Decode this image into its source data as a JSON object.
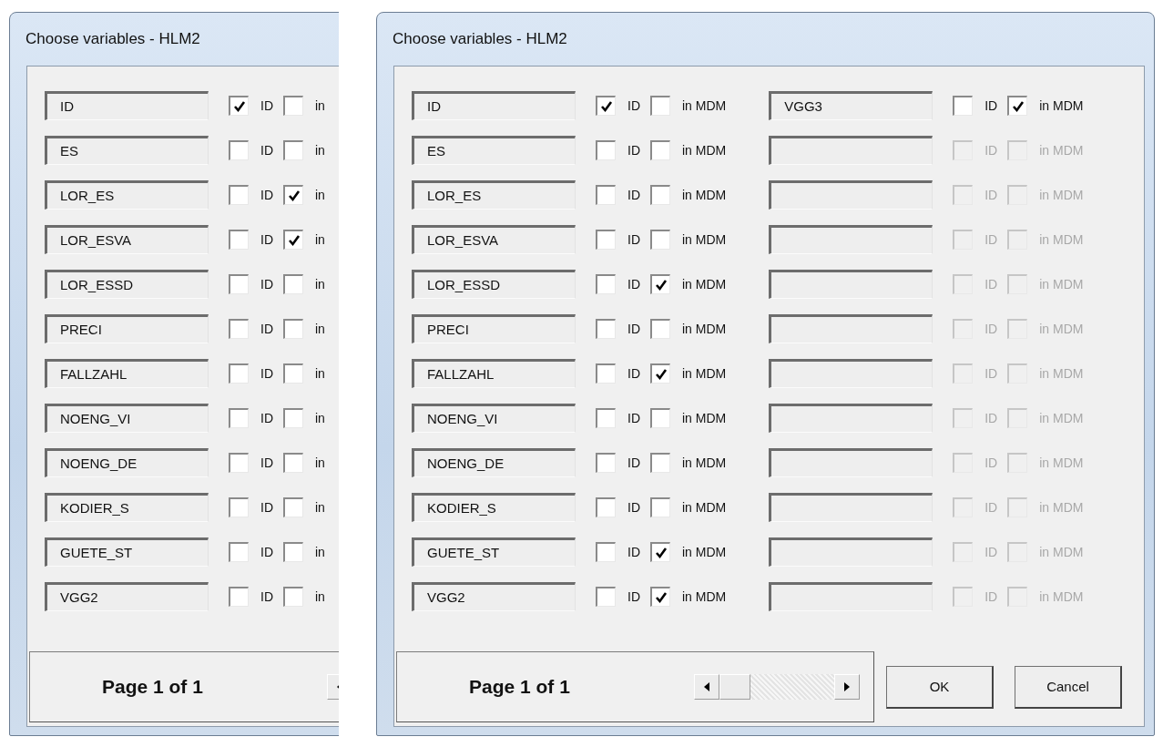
{
  "dialogs": [
    {
      "title": "Choose variables - HLM2",
      "columns": [
        {
          "rows": [
            {
              "field": "ID",
              "id_checked": true,
              "id_label": "ID",
              "mdm_checked": false,
              "mdm_label": "in",
              "disabled": false
            },
            {
              "field": "ES",
              "id_checked": false,
              "id_label": "ID",
              "mdm_checked": false,
              "mdm_label": "in",
              "disabled": false
            },
            {
              "field": "LOR_ES",
              "id_checked": false,
              "id_label": "ID",
              "mdm_checked": true,
              "mdm_label": "in",
              "disabled": false
            },
            {
              "field": "LOR_ESVA",
              "id_checked": false,
              "id_label": "ID",
              "mdm_checked": true,
              "mdm_label": "in",
              "disabled": false
            },
            {
              "field": "LOR_ESSD",
              "id_checked": false,
              "id_label": "ID",
              "mdm_checked": false,
              "mdm_label": "in",
              "disabled": false
            },
            {
              "field": "PRECI",
              "id_checked": false,
              "id_label": "ID",
              "mdm_checked": false,
              "mdm_label": "in",
              "disabled": false
            },
            {
              "field": "FALLZAHL",
              "id_checked": false,
              "id_label": "ID",
              "mdm_checked": false,
              "mdm_label": "in",
              "disabled": false
            },
            {
              "field": "NOENG_VI",
              "id_checked": false,
              "id_label": "ID",
              "mdm_checked": false,
              "mdm_label": "in",
              "disabled": false
            },
            {
              "field": "NOENG_DE",
              "id_checked": false,
              "id_label": "ID",
              "mdm_checked": false,
              "mdm_label": "in",
              "disabled": false
            },
            {
              "field": "KODIER_S",
              "id_checked": false,
              "id_label": "ID",
              "mdm_checked": false,
              "mdm_label": "in",
              "disabled": false
            },
            {
              "field": "GUETE_ST",
              "id_checked": false,
              "id_label": "ID",
              "mdm_checked": false,
              "mdm_label": "in",
              "disabled": false
            },
            {
              "field": "VGG2",
              "id_checked": false,
              "id_label": "ID",
              "mdm_checked": false,
              "mdm_label": "in",
              "disabled": false
            }
          ]
        }
      ],
      "page_label": "Page 1 of 1",
      "scrollbar": {
        "kind": "cut"
      }
    },
    {
      "title": "Choose variables - HLM2",
      "columns": [
        {
          "rows": [
            {
              "field": "ID",
              "id_checked": true,
              "id_label": "ID",
              "mdm_checked": false,
              "mdm_label": "in MDM",
              "disabled": false
            },
            {
              "field": "ES",
              "id_checked": false,
              "id_label": "ID",
              "mdm_checked": false,
              "mdm_label": "in MDM",
              "disabled": false
            },
            {
              "field": "LOR_ES",
              "id_checked": false,
              "id_label": "ID",
              "mdm_checked": false,
              "mdm_label": "in MDM",
              "disabled": false
            },
            {
              "field": "LOR_ESVA",
              "id_checked": false,
              "id_label": "ID",
              "mdm_checked": false,
              "mdm_label": "in MDM",
              "disabled": false
            },
            {
              "field": "LOR_ESSD",
              "id_checked": false,
              "id_label": "ID",
              "mdm_checked": true,
              "mdm_label": "in MDM",
              "disabled": false
            },
            {
              "field": "PRECI",
              "id_checked": false,
              "id_label": "ID",
              "mdm_checked": false,
              "mdm_label": "in MDM",
              "disabled": false
            },
            {
              "field": "FALLZAHL",
              "id_checked": false,
              "id_label": "ID",
              "mdm_checked": true,
              "mdm_label": "in MDM",
              "disabled": false
            },
            {
              "field": "NOENG_VI",
              "id_checked": false,
              "id_label": "ID",
              "mdm_checked": false,
              "mdm_label": "in MDM",
              "disabled": false
            },
            {
              "field": "NOENG_DE",
              "id_checked": false,
              "id_label": "ID",
              "mdm_checked": false,
              "mdm_label": "in MDM",
              "disabled": false
            },
            {
              "field": "KODIER_S",
              "id_checked": false,
              "id_label": "ID",
              "mdm_checked": false,
              "mdm_label": "in MDM",
              "disabled": false
            },
            {
              "field": "GUETE_ST",
              "id_checked": false,
              "id_label": "ID",
              "mdm_checked": true,
              "mdm_label": "in MDM",
              "disabled": false
            },
            {
              "field": "VGG2",
              "id_checked": false,
              "id_label": "ID",
              "mdm_checked": true,
              "mdm_label": "in MDM",
              "disabled": false
            }
          ]
        },
        {
          "rows": [
            {
              "field": "VGG3",
              "id_checked": false,
              "id_label": "ID",
              "mdm_checked": true,
              "mdm_label": "in MDM",
              "disabled": false
            },
            {
              "id_checked": false,
              "id_label": "ID",
              "mdm_checked": false,
              "mdm_label": "in MDM",
              "disabled": true
            },
            {
              "id_checked": false,
              "id_label": "ID",
              "mdm_checked": false,
              "mdm_label": "in MDM",
              "disabled": true
            },
            {
              "id_checked": false,
              "id_label": "ID",
              "mdm_checked": false,
              "mdm_label": "in MDM",
              "disabled": true
            },
            {
              "id_checked": false,
              "id_label": "ID",
              "mdm_checked": false,
              "mdm_label": "in MDM",
              "disabled": true
            },
            {
              "id_checked": false,
              "id_label": "ID",
              "mdm_checked": false,
              "mdm_label": "in MDM",
              "disabled": true
            },
            {
              "id_checked": false,
              "id_label": "ID",
              "mdm_checked": false,
              "mdm_label": "in MDM",
              "disabled": true
            },
            {
              "id_checked": false,
              "id_label": "ID",
              "mdm_checked": false,
              "mdm_label": "in MDM",
              "disabled": true
            },
            {
              "id_checked": false,
              "id_label": "ID",
              "mdm_checked": false,
              "mdm_label": "in MDM",
              "disabled": true
            },
            {
              "id_checked": false,
              "id_label": "ID",
              "mdm_checked": false,
              "mdm_label": "in MDM",
              "disabled": true
            },
            {
              "id_checked": false,
              "id_label": "ID",
              "mdm_checked": false,
              "mdm_label": "in MDM",
              "disabled": true
            },
            {
              "id_checked": false,
              "id_label": "ID",
              "mdm_checked": false,
              "mdm_label": "in MDM",
              "disabled": true
            }
          ]
        }
      ],
      "page_label": "Page 1 of 1",
      "scrollbar": {
        "kind": "full"
      },
      "buttons": [
        {
          "label": "OK"
        },
        {
          "label": "Cancel"
        }
      ]
    }
  ]
}
